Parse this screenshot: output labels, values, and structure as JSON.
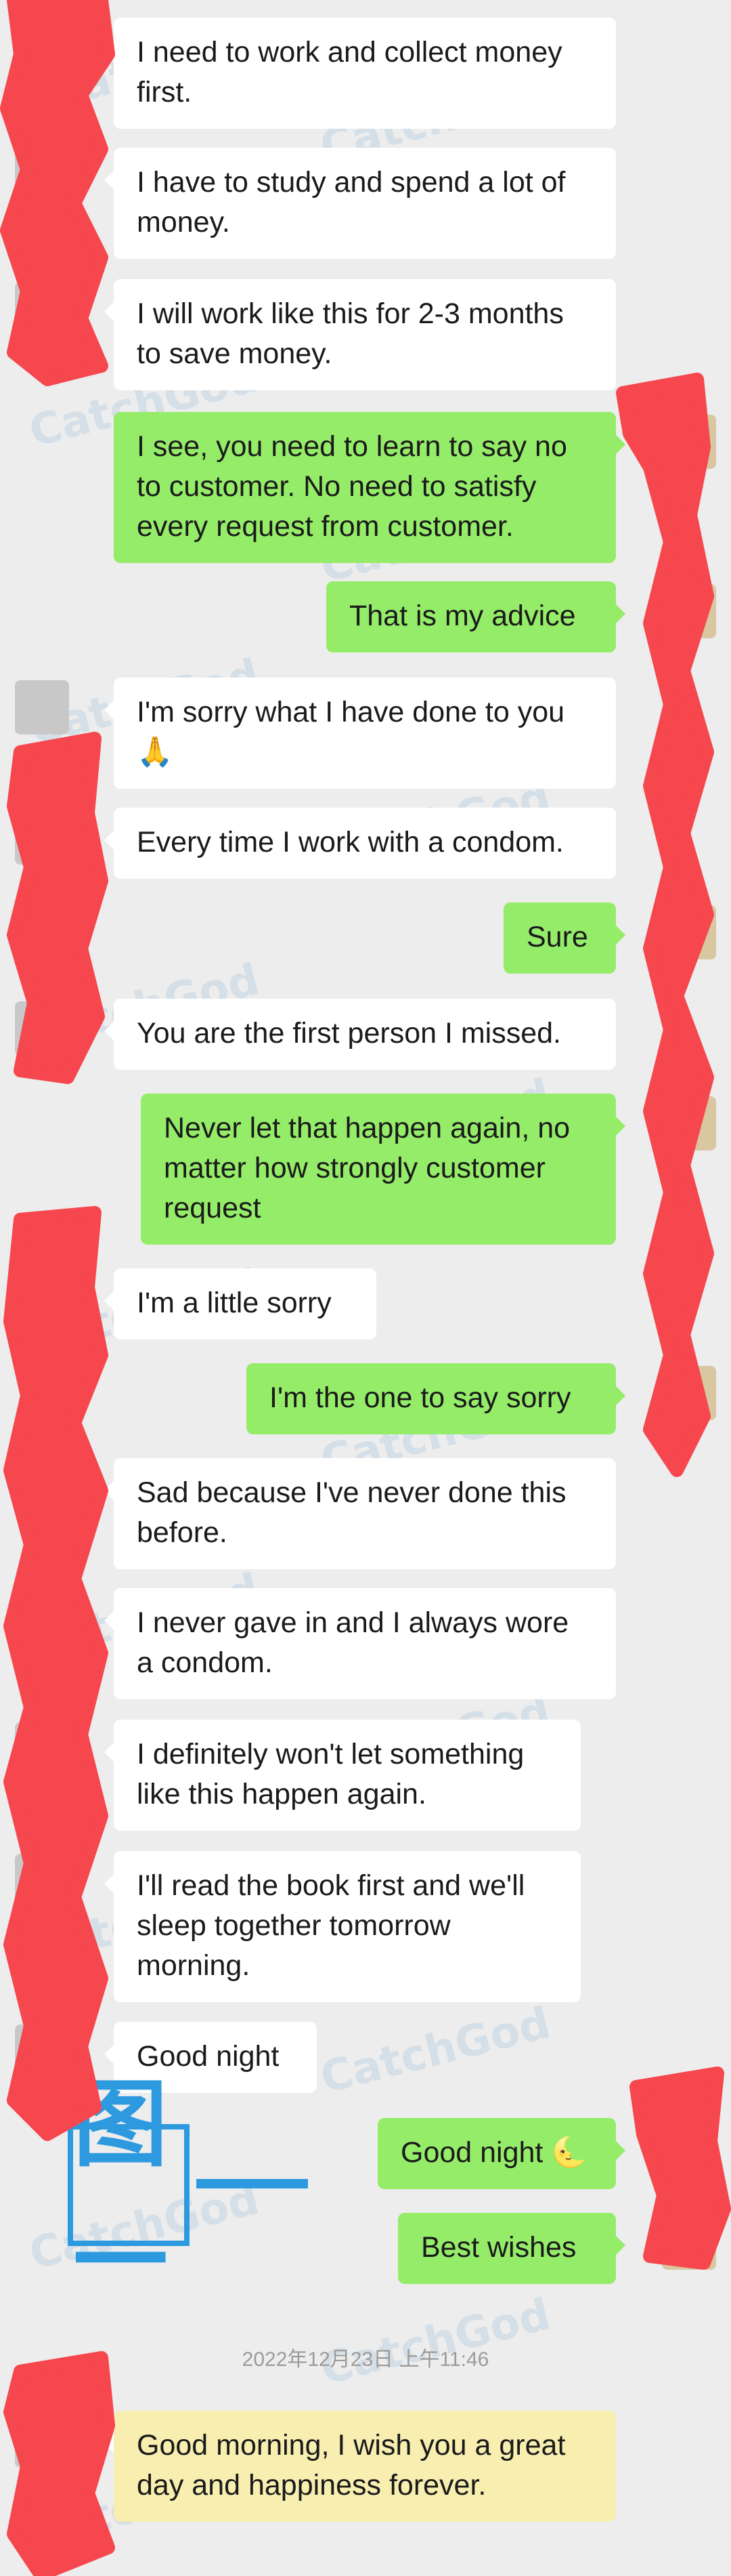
{
  "watermark": "CatchGod",
  "colors": {
    "background": "#ededed",
    "incoming_bubble": "#ffffff",
    "outgoing_bubble": "#95ec69",
    "redaction": "#f5474d",
    "stamp": "#2d9ae0"
  },
  "stamp_label": "图一",
  "timestamp": "2022年12月23日 上午11:46",
  "messages": [
    {
      "side": "left",
      "text": "I need to work and collect money first."
    },
    {
      "side": "left",
      "text": "I have to study and spend a lot of money."
    },
    {
      "side": "left",
      "text": "I will work like this for 2-3 months to save money."
    },
    {
      "side": "right",
      "text": "I see, you need to learn to say no to customer. No need to satisfy every request from customer."
    },
    {
      "side": "right",
      "text": "That is my advice"
    },
    {
      "side": "left",
      "text": "I'm sorry what I have done to you 🙏"
    },
    {
      "side": "left",
      "text": "Every time I work with a condom."
    },
    {
      "side": "right",
      "text": "Sure"
    },
    {
      "side": "left",
      "text": "You are the first person I missed."
    },
    {
      "side": "right",
      "text": "Never let that happen again, no matter how strongly customer request"
    },
    {
      "side": "left",
      "text": "I'm a little sorry"
    },
    {
      "side": "right",
      "text": "I'm the one to say sorry"
    },
    {
      "side": "left",
      "text": "Sad because I've never done this before."
    },
    {
      "side": "left",
      "text": "I never gave in and I always wore a condom."
    },
    {
      "side": "left",
      "text": "I definitely won't let something like this happen again."
    },
    {
      "side": "left",
      "text": "I'll read the book first and we'll sleep together tomorrow morning."
    },
    {
      "side": "left",
      "text": "Good night"
    },
    {
      "side": "right",
      "text": "Good night 🌜"
    },
    {
      "side": "right",
      "text": "Best wishes"
    },
    {
      "side": "left",
      "text": "Good morning, I wish you a great day and happiness forever."
    }
  ]
}
